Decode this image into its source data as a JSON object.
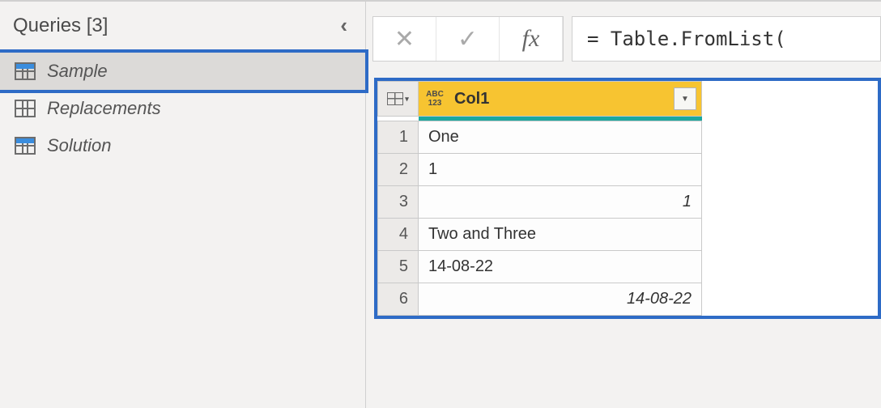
{
  "sidebar": {
    "title": "Queries [3]",
    "items": [
      {
        "label": "Sample",
        "selected": true,
        "blueHead": true
      },
      {
        "label": "Replacements",
        "selected": false,
        "blueHead": false
      },
      {
        "label": "Solution",
        "selected": false,
        "blueHead": true
      }
    ]
  },
  "formula": {
    "cancel_glyph": "✕",
    "accept_glyph": "✓",
    "fx_glyph": "fx",
    "text": "= Table.FromList("
  },
  "grid": {
    "type_icon_top": "ABC",
    "type_icon_bottom": "123",
    "column_name": "Col1",
    "dropdown_glyph": "▼",
    "rows": [
      {
        "index": "1",
        "value": "One",
        "align": "left"
      },
      {
        "index": "2",
        "value": "1",
        "align": "left"
      },
      {
        "index": "3",
        "value": "1",
        "align": "right"
      },
      {
        "index": "4",
        "value": "Two and Three",
        "align": "left"
      },
      {
        "index": "5",
        "value": "14-08-22",
        "align": "left"
      },
      {
        "index": "6",
        "value": "14-08-22",
        "align": "right"
      }
    ]
  }
}
